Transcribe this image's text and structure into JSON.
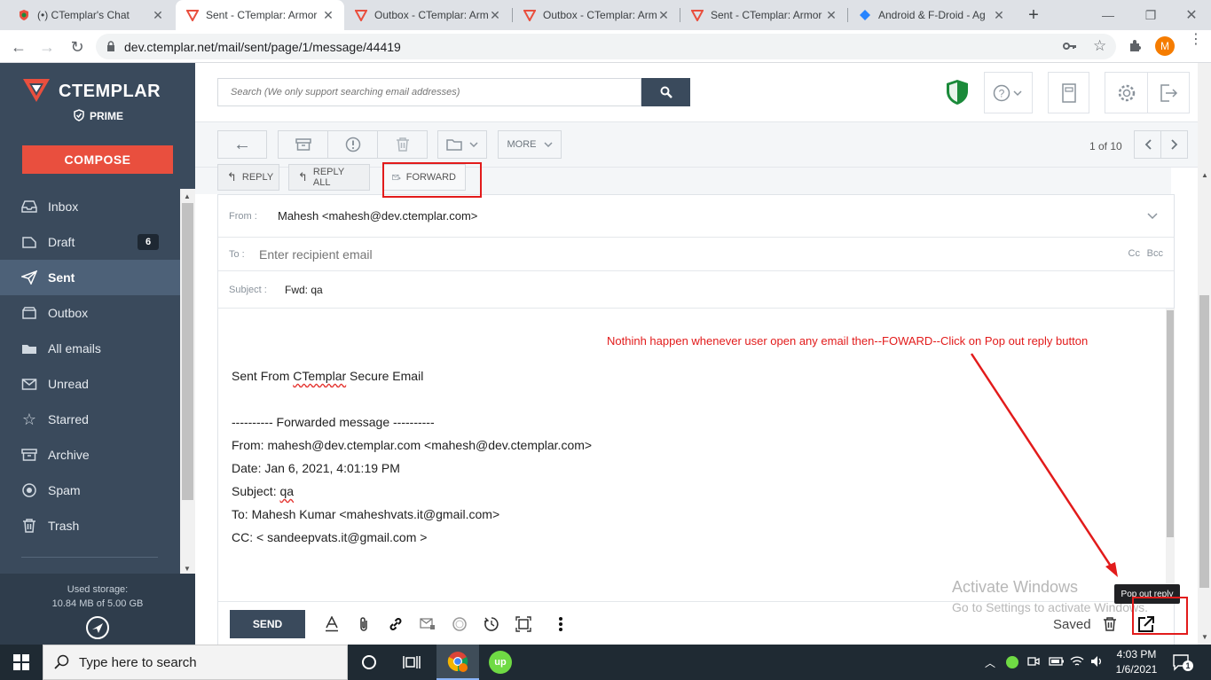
{
  "browser": {
    "tabs": [
      {
        "label": "(•) CTemplar's Chat",
        "icon": "ctemplar-shield-icon"
      },
      {
        "label": "Sent - CTemplar: Armor",
        "icon": "ctemplar-logo-icon",
        "active": true
      },
      {
        "label": "Outbox - CTemplar: Arm",
        "icon": "ctemplar-logo-icon"
      },
      {
        "label": "Outbox - CTemplar: Arm",
        "icon": "ctemplar-logo-icon"
      },
      {
        "label": "Sent - CTemplar: Armor",
        "icon": "ctemplar-logo-icon"
      },
      {
        "label": "Android & F-Droid - Ag",
        "icon": "jira-icon"
      }
    ],
    "url": "dev.ctemplar.net/mail/sent/page/1/message/44419",
    "profile_initial": "M"
  },
  "sidebar": {
    "brand": "CTEMPLAR",
    "plan": "PRIME",
    "compose_label": "COMPOSE",
    "items": [
      {
        "label": "Inbox",
        "icon": "inbox-icon"
      },
      {
        "label": "Draft",
        "icon": "draft-icon",
        "badge": "6"
      },
      {
        "label": "Sent",
        "icon": "send-icon",
        "active": true
      },
      {
        "label": "Outbox",
        "icon": "outbox-icon"
      },
      {
        "label": "All emails",
        "icon": "folder-icon"
      },
      {
        "label": "Unread",
        "icon": "envelope-icon"
      },
      {
        "label": "Starred",
        "icon": "star-icon"
      },
      {
        "label": "Archive",
        "icon": "archive-icon"
      },
      {
        "label": "Spam",
        "icon": "spam-icon"
      },
      {
        "label": "Trash",
        "icon": "trash-icon"
      }
    ],
    "storage_label": "Used storage:",
    "storage_value": "10.84 MB of 5.00 GB"
  },
  "topbar": {
    "search_placeholder": "Search (We only support searching email addresses)"
  },
  "toolbar": {
    "more_label": "MORE",
    "pagination": "1 of 10"
  },
  "reply_actions": {
    "reply": "REPLY",
    "reply_all": "REPLY ALL",
    "forward": "FORWARD"
  },
  "compose": {
    "from_label": "From :",
    "from_value": "Mahesh <mahesh@dev.ctemplar.com>",
    "to_label": "To :",
    "to_placeholder": "Enter recipient email",
    "cc_label": "Cc",
    "bcc_label": "Bcc",
    "subject_label": "Subject :",
    "subject_value": "Fwd: qa",
    "body": {
      "signature_prefix": "Sent From ",
      "signature_brand": "CTemplar",
      "signature_suffix": " Secure Email",
      "fwd_header": "---------- Forwarded message ----------",
      "from_line": "From: mahesh@dev.ctemplar.com <mahesh@dev.ctemplar.com>",
      "date_line": "Date: Jan 6, 2021, 4:01:19 PM",
      "subject_prefix": "Subject: ",
      "subject_word": "qa",
      "to_line": "To: Mahesh Kumar <maheshvats.it@gmail.com>",
      "cc_line": "CC: < sandeepvats.it@gmail.com >"
    },
    "send_label": "SEND",
    "saved_label": "Saved",
    "popout_tooltip": "Pop out reply"
  },
  "annotation": {
    "note": "Nothinh happen whenever user open any email then--FOWARD--Click on Pop out reply button"
  },
  "watermark": {
    "line1": "Activate Windows",
    "line2": "Go to Settings to activate Windows."
  },
  "taskbar": {
    "search_placeholder": "Type here to search",
    "time": "4:03 PM",
    "date": "1/6/2021",
    "notification_count": "1"
  },
  "colors": {
    "sidebar_bg": "#3a4a5c",
    "compose_red": "#e94f3e",
    "annotation_red": "#e21b1b",
    "shield_green": "#1b8a3a"
  }
}
